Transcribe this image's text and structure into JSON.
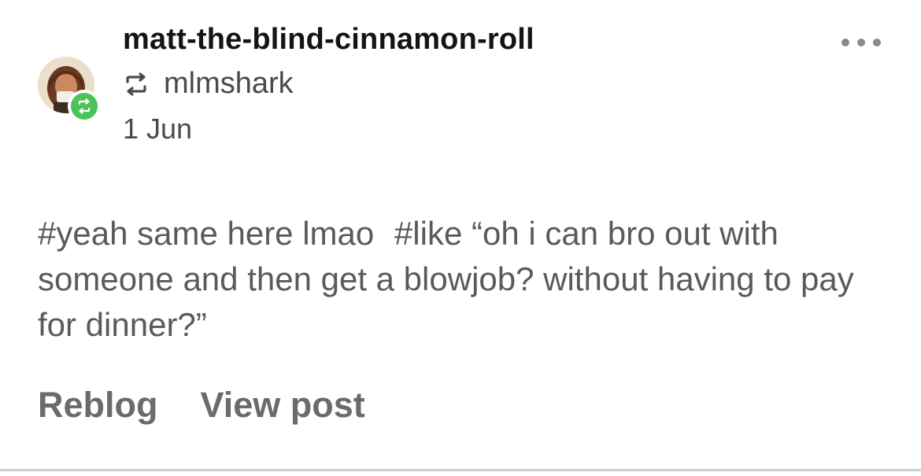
{
  "post": {
    "username": "matt-the-blind-cinnamon-roll",
    "reblogged_from": "mlmshark",
    "date": "1 Jun",
    "tags": [
      "#yeah same here lmao",
      "#like “oh i can bro out with someone and then get a blowjob? without having to pay for dinner?”"
    ],
    "actions": {
      "reblog": "Reblog",
      "view_post": "View post"
    },
    "icons": {
      "reblog_badge": "reblog-icon",
      "reblogged_from": "reblog-icon",
      "more": "more-horizontal-icon"
    },
    "colors": {
      "reblog_badge": "#4bc25a"
    }
  }
}
